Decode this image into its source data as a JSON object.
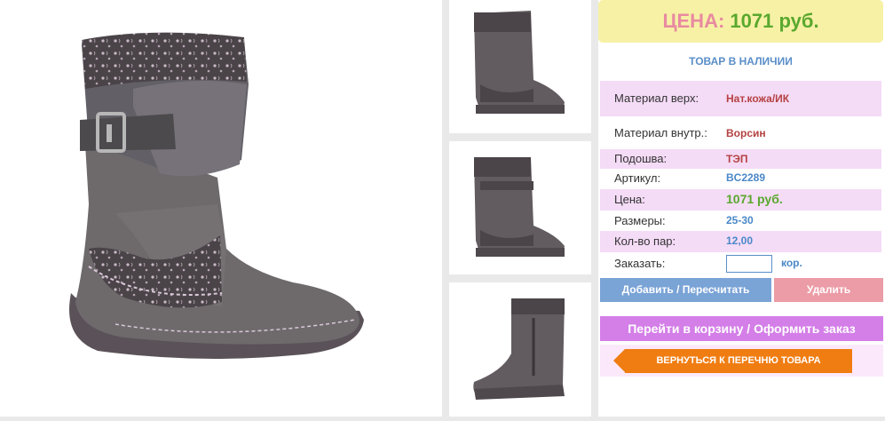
{
  "price_box": {
    "label": "ЦЕНА:",
    "value": "1071 руб."
  },
  "stock_status": "ТОВАР В НАЛИЧИИ",
  "specs": [
    {
      "label": "Материал верх:",
      "value": "Нат.кожа/ИК"
    },
    {
      "label": "Материал внутр.:",
      "value": "Ворсин"
    },
    {
      "label": "Подошва:",
      "value": "ТЭП"
    },
    {
      "label": "Артикул:",
      "value": "BC2289"
    },
    {
      "label": "Цена:",
      "value": "1071 руб."
    },
    {
      "label": "Размеры:",
      "value": "25-30"
    },
    {
      "label": "Кол-во пар:",
      "value": "12,00"
    }
  ],
  "order": {
    "label": "Заказать:",
    "unit": "кор.",
    "quantity_value": ""
  },
  "buttons": {
    "add": "Добавить / Пересчитать",
    "delete": "Удалить",
    "cart": "Перейти в корзину / Оформить заказ",
    "back": "ВЕРНУТЬСЯ К ПЕРЕЧНЮ ТОВАРА"
  },
  "colors": {
    "price_box_bg": "#f7f1a6",
    "spec_highlight": "#f4dbf6",
    "add_button": "#7aa3d6",
    "delete_button": "#ec9ca6",
    "cart_button": "#d47ee8",
    "back_button": "#f07d12"
  }
}
